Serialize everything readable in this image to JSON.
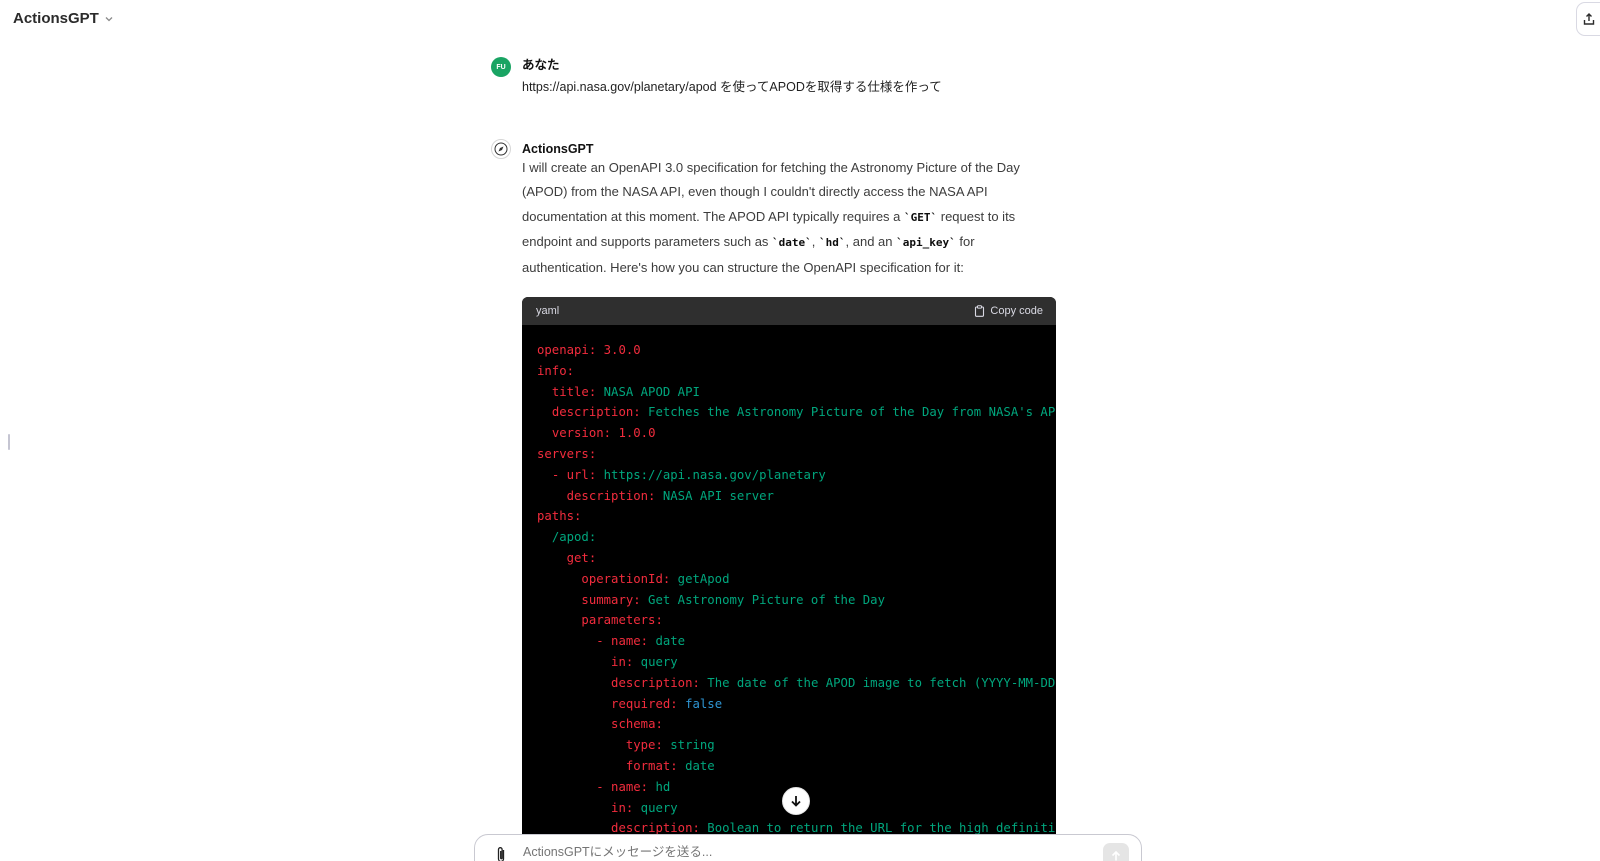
{
  "header": {
    "title": "ActionsGPT"
  },
  "user_message": {
    "avatar_initials": "FU",
    "author": "あなた",
    "text": "https://api.nasa.gov/planetary/apod を使ってAPODを取得する仕様を作って"
  },
  "bot_message": {
    "author": "ActionsGPT",
    "parts": [
      "I will create an OpenAPI 3.0 specification for fetching the Astronomy Picture of the Day (APOD) from the NASA API, even though I couldn't directly access the NASA API documentation at this moment. The APOD API typically requires a ",
      "`GET`",
      " request to its endpoint and supports parameters such as ",
      "`date`",
      ", ",
      "`hd`",
      ", and an ",
      "`api_key`",
      " for authentication. Here's how you can structure the OpenAPI specification for it:"
    ]
  },
  "code_block": {
    "language": "yaml",
    "copy_label": "Copy code",
    "lines": [
      {
        "indent": "",
        "key": "openapi:",
        "value": " 3.0.0",
        "value_kind": "k"
      },
      {
        "indent": "",
        "key": "info:",
        "value": "",
        "value_kind": "v"
      },
      {
        "indent": "  ",
        "key": "title:",
        "value": " NASA APOD API",
        "value_kind": "v"
      },
      {
        "indent": "  ",
        "key": "description:",
        "value": " Fetches the Astronomy Picture of the Day from NASA's API",
        "value_kind": "v"
      },
      {
        "indent": "  ",
        "key": "version:",
        "value": " 1.0.0",
        "value_kind": "k"
      },
      {
        "indent": "",
        "key": "servers:",
        "value": "",
        "value_kind": "v"
      },
      {
        "indent": "  ",
        "key": "- url:",
        "value": " https://api.nasa.gov/planetary",
        "value_kind": "v"
      },
      {
        "indent": "    ",
        "key": "description:",
        "value": " NASA API server",
        "value_kind": "v"
      },
      {
        "indent": "",
        "key": "paths:",
        "value": "",
        "value_kind": "v"
      },
      {
        "indent": "  ",
        "key": "",
        "value": "/apod:",
        "value_kind": "v"
      },
      {
        "indent": "    ",
        "key": "get:",
        "value": "",
        "value_kind": "v"
      },
      {
        "indent": "      ",
        "key": "operationId:",
        "value": " getApod",
        "value_kind": "v"
      },
      {
        "indent": "      ",
        "key": "summary:",
        "value": " Get Astronomy Picture of the Day",
        "value_kind": "v"
      },
      {
        "indent": "      ",
        "key": "parameters:",
        "value": "",
        "value_kind": "v"
      },
      {
        "indent": "        ",
        "key": "- name:",
        "value": " date",
        "value_kind": "v"
      },
      {
        "indent": "          ",
        "key": "in:",
        "value": " query",
        "value_kind": "v"
      },
      {
        "indent": "          ",
        "key": "description:",
        "value": " The date of the APOD image to fetch (YYYY-MM-DD)",
        "value_kind": "v"
      },
      {
        "indent": "          ",
        "key": "required:",
        "value": " false",
        "value_kind": "b"
      },
      {
        "indent": "          ",
        "key": "schema:",
        "value": "",
        "value_kind": "v"
      },
      {
        "indent": "            ",
        "key": "type:",
        "value": " string",
        "value_kind": "v"
      },
      {
        "indent": "            ",
        "key": "format:",
        "value": " date",
        "value_kind": "v"
      },
      {
        "indent": "        ",
        "key": "- name:",
        "value": " hd",
        "value_kind": "v"
      },
      {
        "indent": "          ",
        "key": "in:",
        "value": " query",
        "value_kind": "v"
      },
      {
        "indent": "          ",
        "key": "description:",
        "value": " Boolean to return the URL for the high definition",
        "value_kind": "v"
      }
    ]
  },
  "composer": {
    "placeholder": "ActionsGPTにメッセージを送る..."
  },
  "colors": {
    "user_avatar": "#19a463",
    "code_bg": "#000000",
    "code_header": "#2f2f2f",
    "yaml_key": "#f22c3d",
    "yaml_string": "#00a67d",
    "yaml_bool": "#2e95d3"
  },
  "icons": [
    "chevron-down-icon",
    "share-icon",
    "compass-logo-icon",
    "clipboard-icon",
    "arrow-down-icon",
    "paperclip-icon",
    "arrow-up-icon"
  ]
}
